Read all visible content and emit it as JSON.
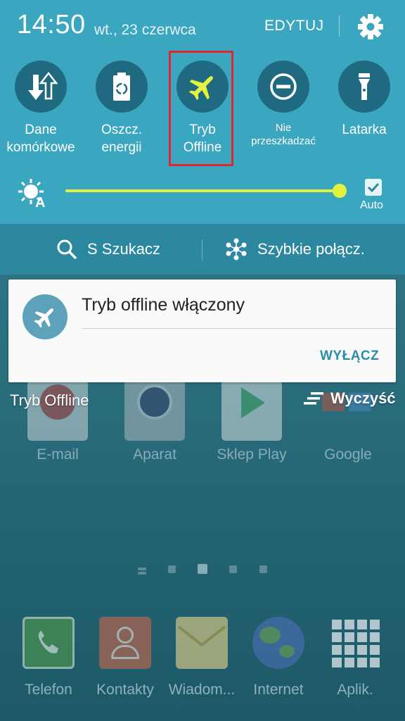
{
  "status_bar": {
    "time": "14:50",
    "date": "wt., 23 czerwca",
    "edit_label": "EDYTUJ",
    "settings_icon": "gear-icon"
  },
  "quick_toggles": [
    {
      "line1": "Dane",
      "line2": "komórkowe",
      "icon": "mobile-data-icon",
      "active": false
    },
    {
      "line1": "Oszcz.",
      "line2": "energii",
      "icon": "power-saving-icon",
      "active": false
    },
    {
      "line1": "Tryb",
      "line2": "Offline",
      "icon": "airplane-icon",
      "active": true
    },
    {
      "line1": "Nie",
      "line2": "przeszkadzać",
      "icon": "do-not-disturb-icon",
      "active": false
    },
    {
      "line1": "Latarka",
      "line2": "",
      "icon": "flashlight-icon",
      "active": false
    }
  ],
  "brightness": {
    "level": 1.0,
    "auto_label": "Auto",
    "auto_checked": true
  },
  "search_bar": {
    "search_label": "S Szukacz",
    "quick_connect_label": "Szybkie połącz."
  },
  "notification": {
    "title": "Tryb offline włączony",
    "action_label": "WYŁĄCZ",
    "icon": "airplane-icon"
  },
  "footer": {
    "mode_label": "Tryb Offline",
    "clear_label": "Wyczyść"
  },
  "home_screen": {
    "apps": [
      "E-mail",
      "Aparat",
      "Sklep Play",
      "Google"
    ],
    "dock": [
      "Telefon",
      "Kontakty",
      "Wiadom...",
      "Internet",
      "Aplik."
    ]
  },
  "colors": {
    "panel_bg": "#3ba6bf",
    "toggle_bg": "#1f6a80",
    "active_accent": "#e3f23e",
    "highlight_border": "#e0262c",
    "action_text": "#2a8ea6"
  }
}
